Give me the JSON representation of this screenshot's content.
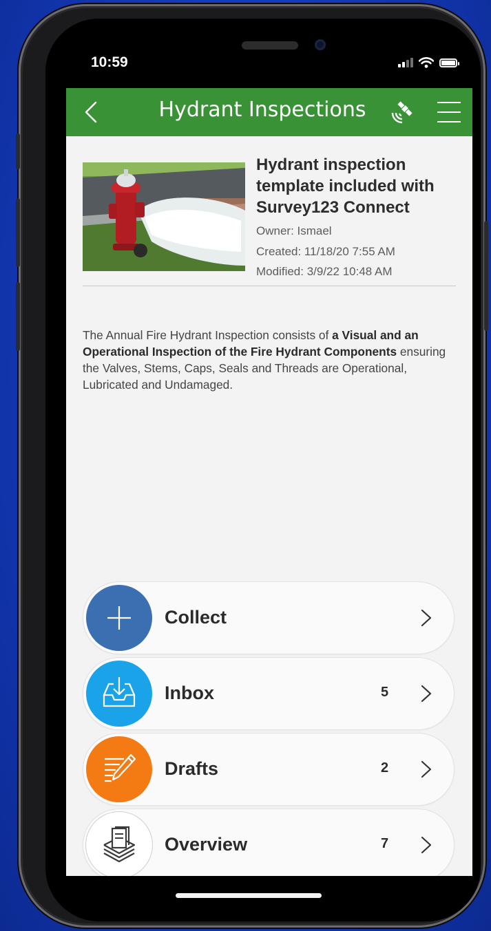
{
  "status_bar": {
    "time": "10:59"
  },
  "header": {
    "title": "Hydrant Inspections"
  },
  "survey": {
    "title": "Hydrant inspection template included with Survey123 Connect",
    "owner": "Owner: Ismael",
    "created": "Created: 11/18/20 7:55 AM",
    "modified": "Modified: 3/9/22 10:48 AM"
  },
  "description": {
    "part1": "The Annual Fire Hydrant Inspection consists of ",
    "bold": "a Visual and an Operational Inspection of the Fire Hydrant Components",
    "part2": " ensuring the Valves, Stems, Caps, Seals and Threads are Operational, Lubricated and Undamaged."
  },
  "actions": [
    {
      "label": "Collect",
      "count": "",
      "color": "#3a70b2",
      "icon": "plus-icon"
    },
    {
      "label": "Inbox",
      "count": "5",
      "color": "#1aa3e8",
      "icon": "inbox-download-icon"
    },
    {
      "label": "Drafts",
      "count": "2",
      "color": "#f47b13",
      "icon": "pencil-lines-icon"
    },
    {
      "label": "Overview",
      "count": "7",
      "color": "#ffffff",
      "icon": "stacked-documents-icon"
    }
  ],
  "colors": {
    "header": "#3a9236",
    "background": "#f3f3f3"
  }
}
